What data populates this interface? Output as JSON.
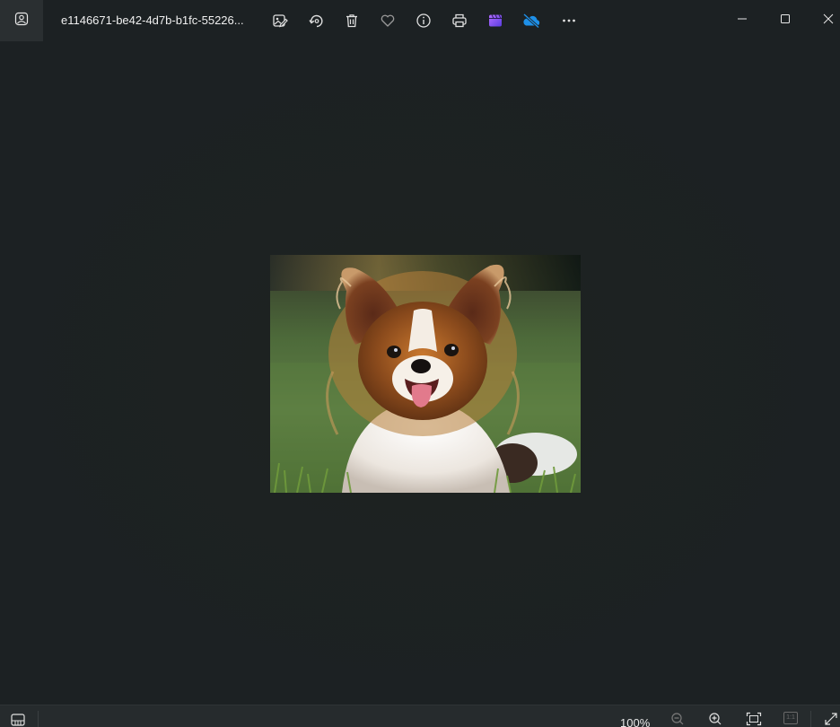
{
  "titlebar": {
    "file_name": "e1146671-be42-4d7b-b1fc-55226...",
    "app_icon": "photos-app-icon",
    "tools": [
      {
        "name": "edit-image",
        "icon": "edit-image-icon"
      },
      {
        "name": "rotate",
        "icon": "rotate-icon"
      },
      {
        "name": "delete",
        "icon": "trash-icon"
      },
      {
        "name": "favorite",
        "icon": "heart-icon"
      },
      {
        "name": "file-info",
        "icon": "info-icon"
      },
      {
        "name": "print",
        "icon": "printer-icon"
      },
      {
        "name": "clipchamp",
        "icon": "clipchamp-icon"
      },
      {
        "name": "onedrive",
        "icon": "onedrive-off-icon"
      },
      {
        "name": "more",
        "icon": "more-icon"
      }
    ],
    "window_controls": [
      "minimize-icon",
      "maximize-icon",
      "close-icon"
    ]
  },
  "image": {
    "subject": "papillon-dog-photo"
  },
  "bottombar": {
    "filmstrip_icon": "filmstrip-icon",
    "zoom_level": "100%",
    "zoom_out_icon": "zoom-out-icon",
    "zoom_in_icon": "zoom-in-icon",
    "fit_icon": "fit-to-window-icon",
    "actual_size_label": "1:1",
    "fullscreen_icon": "fullscreen-icon"
  },
  "colors": {
    "background": "#1c2123",
    "titlebar_active": "#2a2f31",
    "bottombar": "#262b2d",
    "onedrive_accent": "#1e90e8",
    "clipchamp_accent": "#8a5cf5"
  }
}
